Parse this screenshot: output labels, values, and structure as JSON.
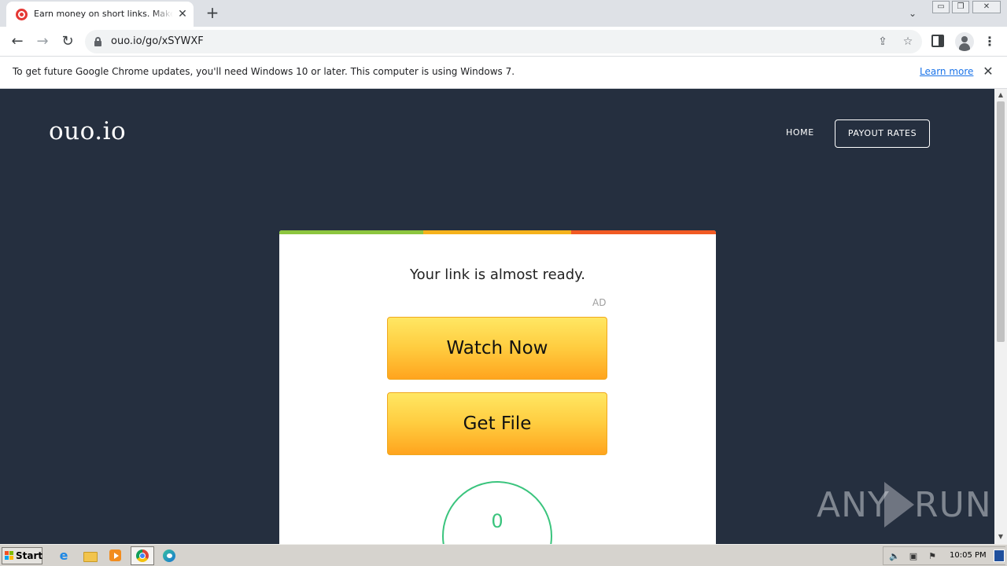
{
  "browser": {
    "tab": {
      "title": "Earn money on short links. Make short links and earn the biggest money - ouo.io",
      "close_glyph": "✕"
    },
    "new_tab_glyph": "+",
    "tab_search_glyph": "⌄",
    "window_controls": {
      "minimize": "▭",
      "maximize": "❐",
      "close": "✕"
    },
    "nav": {
      "back": "←",
      "forward": "→",
      "reload": "↻"
    },
    "address": "ouo.io/go/xSYWXF",
    "share_glyph": "⇪",
    "star_glyph": "☆",
    "menu_glyph": "⋮",
    "infobar": {
      "message": "To get future Google Chrome updates, you'll need Windows 10 or later. This computer is using Windows 7.",
      "link": "Learn more",
      "close_glyph": "✕"
    }
  },
  "site": {
    "logo": "ouo.io",
    "nav": {
      "home": "HOME",
      "payout_rates": "PAYOUT RATES"
    },
    "card": {
      "heading": "Your link is almost ready.",
      "ad_label": "AD",
      "buttons": {
        "watch": "Watch Now",
        "get_file": "Get File"
      },
      "timer": "0",
      "bar_colors": [
        "#8dc63f",
        "#f5b21c",
        "#f15a24"
      ]
    },
    "colors": {
      "background": "#252f3f",
      "accent_green": "#3ac47d"
    }
  },
  "watermark": {
    "left": "ANY",
    "right": "RUN"
  },
  "scrollbar": {
    "up": "▲",
    "down": "▼"
  },
  "taskbar": {
    "start_label": "Start",
    "ie_glyph": "e",
    "tray": {
      "speaker": "🔈",
      "network": "▣",
      "flag": "⚑"
    },
    "clock": "10:05 PM"
  }
}
